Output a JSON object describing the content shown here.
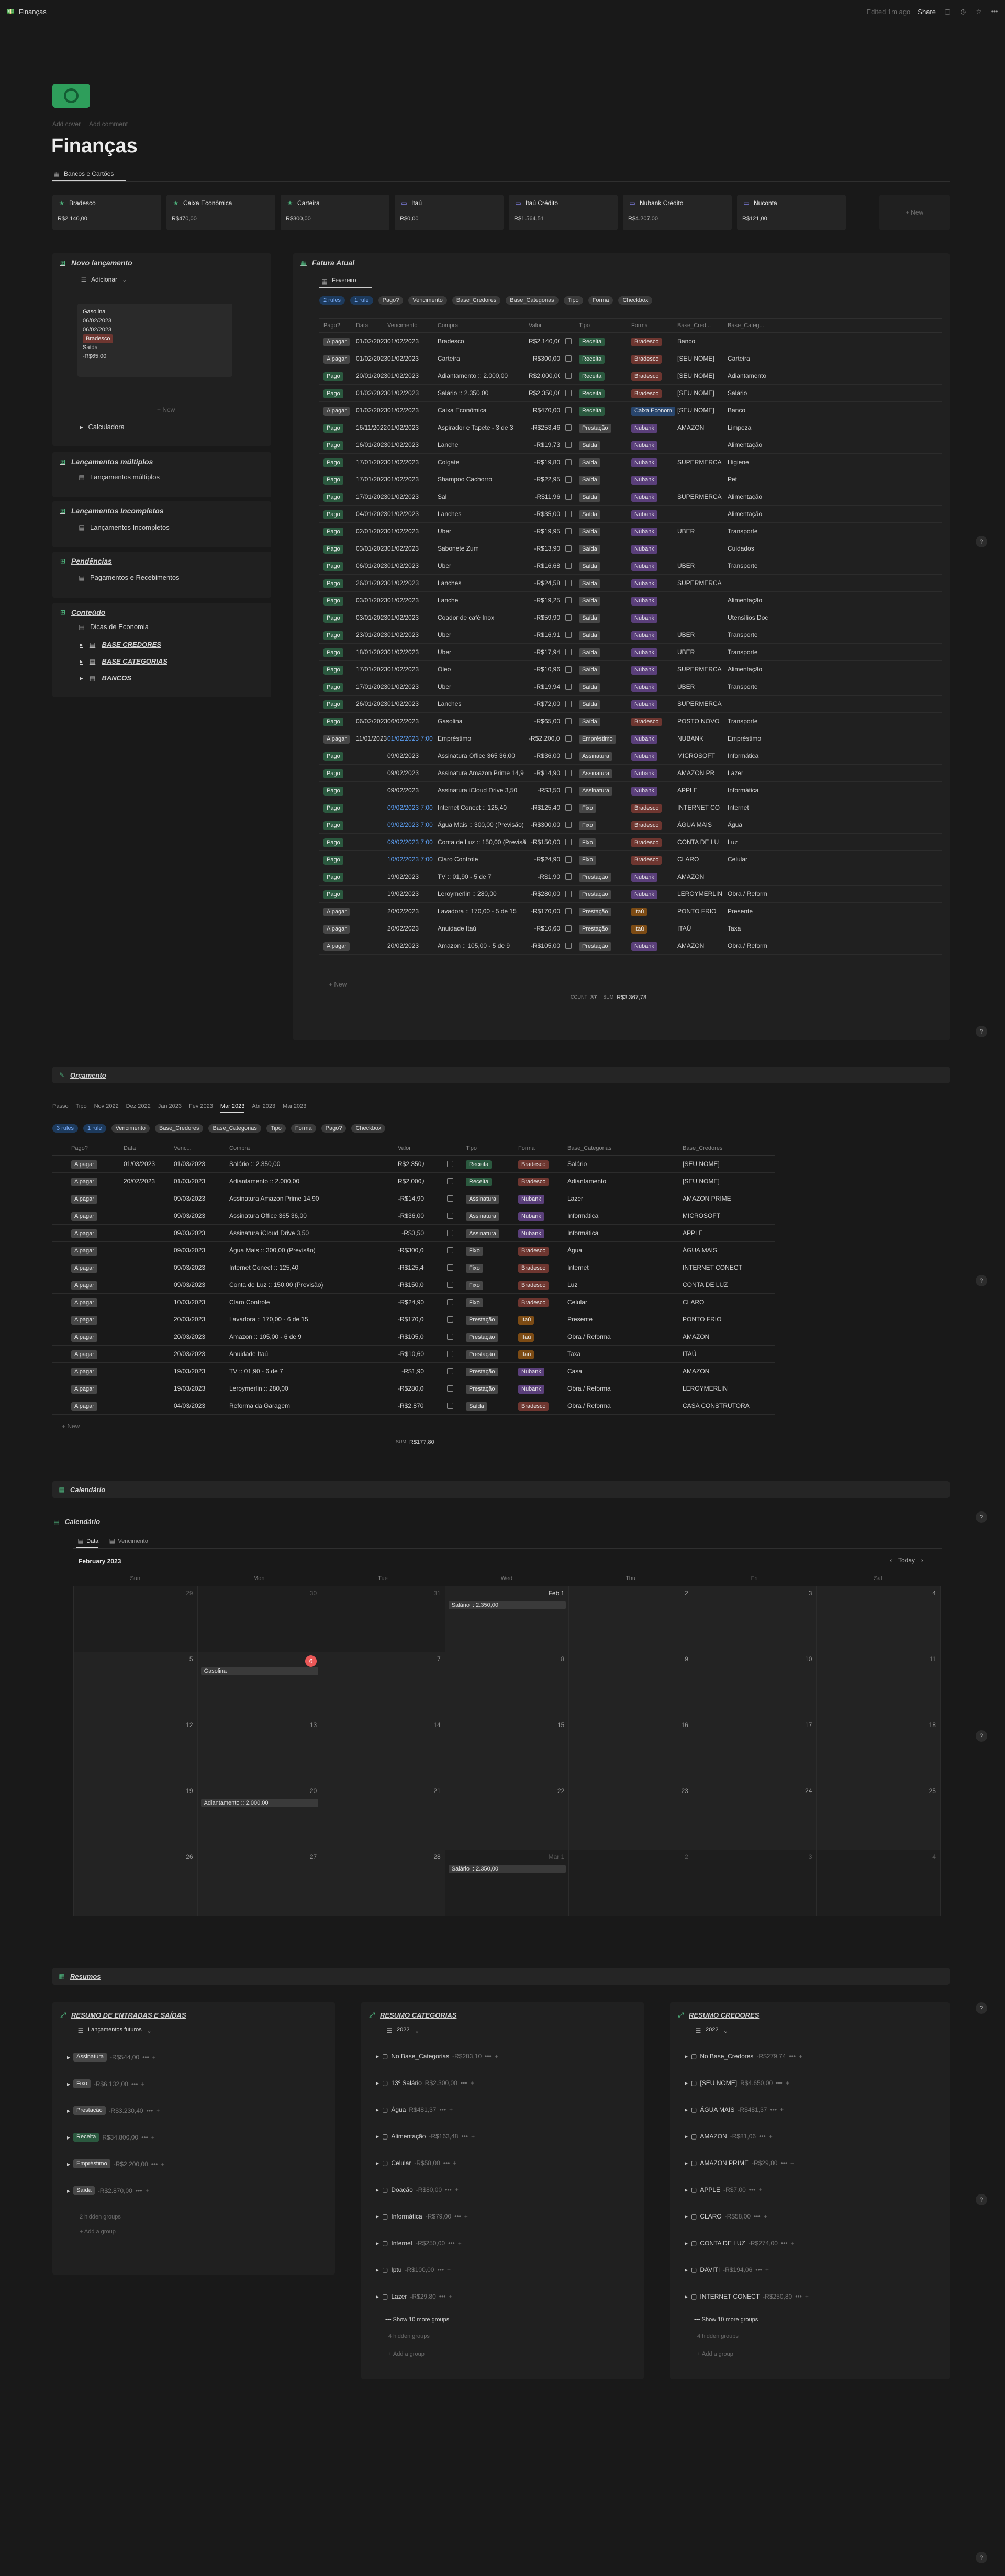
{
  "topbar": {
    "title": "Finanças",
    "edited": "Edited 1m ago",
    "share": "Share"
  },
  "page": {
    "add_cover": "Add cover",
    "add_comment": "Add comment",
    "title": "Finanças",
    "tab": "Bancos e Cartões"
  },
  "accounts": [
    {
      "name": "Bradesco",
      "value": "R$2.140,00",
      "icon": "star-icon"
    },
    {
      "name": "Caixa Econômica",
      "value": "R$470,00",
      "icon": "star-icon"
    },
    {
      "name": "Carteira",
      "value": "R$300,00",
      "icon": "star-icon"
    },
    {
      "name": "Itaú",
      "value": "R$0,00",
      "icon": "card-icon"
    },
    {
      "name": "Itaú Crédito",
      "value": "R$1.564,51",
      "icon": "card-icon"
    },
    {
      "name": "Nubank Crédito",
      "value": "R$4.207,00",
      "icon": "card-icon"
    },
    {
      "name": "Nuconta",
      "value": "R$121,00",
      "icon": "card-icon"
    }
  ],
  "accounts_new": "+ New",
  "left": {
    "novo": {
      "title": "Novo lançamento",
      "button": "Adicionar",
      "card": [
        "Gasolina",
        "06/02/2023",
        "06/02/2023",
        "Bradesco",
        "Saída",
        "-R$65,00"
      ],
      "new": "+ New",
      "calc": "Calculadora"
    },
    "multiplos": {
      "title": "Lançamentos múltiplos",
      "item": "Lançamentos múltiplos"
    },
    "incompletos": {
      "title": "Lançamentos Incompletos",
      "item": "Lançamentos Incompletos"
    },
    "pendencias": {
      "title": "Pendências",
      "item": "Pagamentos e Recebimentos"
    },
    "conteudo": {
      "title": "Conteúdo",
      "items": [
        "Dicas de Economia",
        "BASE CREDORES",
        "BASE CATEGORIAS",
        "BANCOS"
      ]
    }
  },
  "fatura": {
    "title": "Fatura Atual",
    "tab": "Fevereiro",
    "filters": [
      "Pago?",
      "Vencimento",
      "Base_Credores",
      "Base_Categorias",
      "Tipo",
      "Forma",
      "Checkbox"
    ],
    "filter_active1": "2 rules",
    "filter_active2": "1 rule",
    "headers": [
      "Pago?",
      "Data",
      "Vencimento",
      "Compra",
      "Valor",
      "",
      "Tipo",
      "Forma",
      "Base_Cred...",
      "Base_Categ..."
    ],
    "rows": [
      [
        "A pagar",
        "01/02/2023",
        "01/02/2023",
        "Bradesco",
        "R$2.140,00",
        "Receita",
        "Bradesco",
        "Banco",
        ""
      ],
      [
        "A pagar",
        "01/02/2023",
        "01/02/2023",
        "Carteira",
        "R$300,00",
        "Receita",
        "Bradesco",
        "[SEU NOME]",
        "Carteira"
      ],
      [
        "Pago",
        "20/01/2023",
        "01/02/2023",
        "Adiantamento :: 2.000,00",
        "R$2.000,00",
        "Receita",
        "Bradesco",
        "[SEU NOME]",
        "Adiantamento"
      ],
      [
        "Pago",
        "01/02/2023",
        "01/02/2023",
        "Salário :: 2.350,00",
        "R$2.350,00",
        "Receita",
        "Bradesco",
        "[SEU NOME]",
        "Salário"
      ],
      [
        "A pagar",
        "01/02/2023",
        "01/02/2023",
        "Caixa Econômica",
        "R$470,00",
        "Receita",
        "Caixa Econom",
        "[SEU NOME]",
        "Banco"
      ],
      [
        "Pago",
        "16/11/2022",
        "01/02/2023",
        "Aspirador e Tapete - 3 de 3",
        "-R$253,46",
        "Prestação",
        "Nubank",
        "AMAZON",
        "Limpeza"
      ],
      [
        "Pago",
        "16/01/2023",
        "01/02/2023",
        "Lanche",
        "-R$19,73",
        "Saída",
        "Nubank",
        "",
        "Alimentação"
      ],
      [
        "Pago",
        "17/01/2023",
        "01/02/2023",
        "Colgate",
        "-R$19,80",
        "Saída",
        "Nubank",
        "SUPERMERCA",
        "Higiene"
      ],
      [
        "Pago",
        "17/01/2023",
        "01/02/2023",
        "Shampoo Cachorro",
        "-R$22,95",
        "Saída",
        "Nubank",
        "",
        "Pet"
      ],
      [
        "Pago",
        "17/01/2023",
        "01/02/2023",
        "Sal",
        "-R$11,96",
        "Saída",
        "Nubank",
        "SUPERMERCA",
        "Alimentação"
      ],
      [
        "Pago",
        "04/01/2023",
        "01/02/2023",
        "Lanches",
        "-R$35,00",
        "Saída",
        "Nubank",
        "",
        "Alimentação"
      ],
      [
        "Pago",
        "02/01/2023",
        "01/02/2023",
        "Uber",
        "-R$19,95",
        "Saída",
        "Nubank",
        "UBER",
        "Transporte"
      ],
      [
        "Pago",
        "03/01/2023",
        "01/02/2023",
        "Sabonete Zum",
        "-R$13,90",
        "Saída",
        "Nubank",
        "",
        "Cuidados"
      ],
      [
        "Pago",
        "06/01/2023",
        "01/02/2023",
        "Uber",
        "-R$16,68",
        "Saída",
        "Nubank",
        "UBER",
        "Transporte"
      ],
      [
        "Pago",
        "26/01/2023",
        "01/02/2023",
        "Lanches",
        "-R$24,58",
        "Saída",
        "Nubank",
        "SUPERMERCA",
        ""
      ],
      [
        "Pago",
        "03/01/2023",
        "01/02/2023",
        "Lanche",
        "-R$19,25",
        "Saída",
        "Nubank",
        "",
        "Alimentação"
      ],
      [
        "Pago",
        "03/01/2023",
        "01/02/2023",
        "Coador de café Inox",
        "-R$59,90",
        "Saída",
        "Nubank",
        "",
        "Utensílios Doc"
      ],
      [
        "Pago",
        "23/01/2023",
        "01/02/2023",
        "Uber",
        "-R$16,91",
        "Saída",
        "Nubank",
        "UBER",
        "Transporte"
      ],
      [
        "Pago",
        "18/01/2023",
        "01/02/2023",
        "Uber",
        "-R$17,94",
        "Saída",
        "Nubank",
        "UBER",
        "Transporte"
      ],
      [
        "Pago",
        "17/01/2023",
        "01/02/2023",
        "Óleo",
        "-R$10,96",
        "Saída",
        "Nubank",
        "SUPERMERCA",
        "Alimentação"
      ],
      [
        "Pago",
        "17/01/2023",
        "01/02/2023",
        "Uber",
        "-R$19,94",
        "Saída",
        "Nubank",
        "UBER",
        "Transporte"
      ],
      [
        "Pago",
        "26/01/2023",
        "01/02/2023",
        "Lanches",
        "-R$72,00",
        "Saída",
        "Nubank",
        "SUPERMERCA",
        ""
      ],
      [
        "Pago",
        "06/02/2023",
        "06/02/2023",
        "Gasolina",
        "-R$65,00",
        "Saída",
        "Bradesco",
        "POSTO NOVO",
        "Transporte"
      ],
      [
        "A pagar",
        "11/01/2023",
        "01/02/2023 7:00",
        "Empréstimo",
        "-R$2.200,00",
        "Empréstimo",
        "Nubank",
        "NUBANK",
        "Empréstimo"
      ],
      [
        "Pago",
        "",
        "09/02/2023",
        "Assinatura Office 365 36,00",
        "-R$36,00",
        "Assinatura",
        "Nubank",
        "MICROSOFT",
        "Informática"
      ],
      [
        "Pago",
        "",
        "09/02/2023",
        "Assinatura Amazon Prime 14,9",
        "-R$14,90",
        "Assinatura",
        "Nubank",
        "AMAZON PR",
        "Lazer"
      ],
      [
        "Pago",
        "",
        "09/02/2023",
        "Assinatura iCloud Drive 3,50",
        "-R$3,50",
        "Assinatura",
        "Nubank",
        "APPLE",
        "Informática"
      ],
      [
        "Pago",
        "",
        "09/02/2023 7:00",
        "Internet Conect :: 125,40",
        "-R$125,40",
        "Fixo",
        "Bradesco",
        "INTERNET CO",
        "Internet"
      ],
      [
        "Pago",
        "",
        "09/02/2023 7:00",
        "Água Mais :: 300,00 (Previsão)",
        "-R$300,00",
        "Fixo",
        "Bradesco",
        "ÁGUA MAIS",
        "Água"
      ],
      [
        "Pago",
        "",
        "09/02/2023 7:00",
        "Conta de Luz :: 150,00 (Previsã",
        "-R$150,00",
        "Fixo",
        "Bradesco",
        "CONTA DE LU",
        "Luz"
      ],
      [
        "Pago",
        "",
        "10/02/2023 7:00",
        "Claro Controle",
        "-R$24,90",
        "Fixo",
        "Bradesco",
        "CLARO",
        "Celular"
      ],
      [
        "Pago",
        "",
        "19/02/2023",
        "TV :: 01,90 - 5 de 7",
        "-R$1,90",
        "Prestação",
        "Nubank",
        "AMAZON",
        ""
      ],
      [
        "Pago",
        "",
        "19/02/2023",
        "Leroymerlin :: 280,00",
        "-R$280,00",
        "Prestação",
        "Nubank",
        "LEROYMERLIN",
        "Obra / Reform"
      ],
      [
        "A pagar",
        "",
        "20/02/2023",
        "Lavadora :: 170,00 - 5 de 15",
        "-R$170,00",
        "Prestação",
        "Itaú",
        "PONTO FRIO",
        "Presente"
      ],
      [
        "A pagar",
        "",
        "20/02/2023",
        "Anuidade Itaú",
        "-R$10,60",
        "Prestação",
        "Itaú",
        "ITAÚ",
        "Taxa"
      ],
      [
        "A pagar",
        "",
        "20/02/2023",
        "Amazon :: 105,00 - 5 de 9",
        "-R$105,00",
        "Prestação",
        "Nubank",
        "AMAZON",
        "Obra / Reform"
      ]
    ],
    "new": "+ New",
    "count_label": "COUNT",
    "count": "37",
    "sum_label": "SUM",
    "sum": "R$3.367,78"
  },
  "orcamento": {
    "title": "Orçamento",
    "tabs": [
      "Passo",
      "Tipo",
      "Nov 2022",
      "Dez 2022",
      "Jan 2023",
      "Fev 2023",
      "Mar 2023",
      "Abr 2023",
      "Mai 2023"
    ],
    "active": "Mar 2023",
    "filters": [
      "Vencimento",
      "Base_Credores",
      "Base_Categorias",
      "Tipo",
      "Forma",
      "Pago?",
      "Checkbox"
    ],
    "filter_active1": "3 rules",
    "filter_active2": "1 rule",
    "headers": [
      "Pago?",
      "Data",
      "Venc...",
      "Compra",
      "Valor",
      "",
      "Tipo",
      "Forma",
      "Base_Categorias",
      "Base_Credores"
    ],
    "rows": [
      [
        "A pagar",
        "01/03/2023",
        "01/03/2023",
        "Salário :: 2.350,00",
        "R$2.350,00",
        "Receita",
        "Bradesco",
        "Salário",
        "[SEU NOME]"
      ],
      [
        "A pagar",
        "20/02/2023",
        "01/03/2023",
        "Adiantamento :: 2.000,00",
        "R$2.000,00",
        "Receita",
        "Bradesco",
        "Adiantamento",
        "[SEU NOME]"
      ],
      [
        "A pagar",
        "",
        "09/03/2023",
        "Assinatura Amazon Prime 14,90",
        "-R$14,90",
        "Assinatura",
        "Nubank",
        "Lazer",
        "AMAZON PRIME"
      ],
      [
        "A pagar",
        "",
        "09/03/2023",
        "Assinatura Office 365 36,00",
        "-R$36,00",
        "Assinatura",
        "Nubank",
        "Informática",
        "MICROSOFT"
      ],
      [
        "A pagar",
        "",
        "09/03/2023",
        "Assinatura iCloud Drive 3,50",
        "-R$3,50",
        "Assinatura",
        "Nubank",
        "Informática",
        "APPLE"
      ],
      [
        "A pagar",
        "",
        "09/03/2023",
        "Água Mais :: 300,00 (Previsão)",
        "-R$300,00",
        "Fixo",
        "Bradesco",
        "Água",
        "ÁGUA MAIS"
      ],
      [
        "A pagar",
        "",
        "09/03/2023",
        "Internet Conect :: 125,40",
        "-R$125,40",
        "Fixo",
        "Bradesco",
        "Internet",
        "INTERNET CONECT"
      ],
      [
        "A pagar",
        "",
        "09/03/2023",
        "Conta de Luz :: 150,00 (Previsão)",
        "-R$150,00",
        "Fixo",
        "Bradesco",
        "Luz",
        "CONTA DE LUZ"
      ],
      [
        "A pagar",
        "",
        "10/03/2023",
        "Claro Controle",
        "-R$24,90",
        "Fixo",
        "Bradesco",
        "Celular",
        "CLARO"
      ],
      [
        "A pagar",
        "",
        "20/03/2023",
        "Lavadora :: 170,00 - 6 de 15",
        "-R$170,00",
        "Prestação",
        "Itaú",
        "Presente",
        "PONTO FRIO"
      ],
      [
        "A pagar",
        "",
        "20/03/2023",
        "Amazon :: 105,00 - 6 de 9",
        "-R$105,00",
        "Prestação",
        "Itaú",
        "Obra / Reforma",
        "AMAZON"
      ],
      [
        "A pagar",
        "",
        "20/03/2023",
        "Anuidade Itaú",
        "-R$10,60",
        "Prestação",
        "Itaú",
        "Taxa",
        "ITAÚ"
      ],
      [
        "A pagar",
        "",
        "19/03/2023",
        "TV :: 01,90 - 6 de 7",
        "-R$1,90",
        "Prestação",
        "Nubank",
        "Casa",
        "AMAZON"
      ],
      [
        "A pagar",
        "",
        "19/03/2023",
        "Leroymerlin :: 280,00",
        "-R$280,00",
        "Prestação",
        "Nubank",
        "Obra / Reforma",
        "LEROYMERLIN"
      ],
      [
        "A pagar",
        "",
        "04/03/2023",
        "Reforma da Garagem",
        "-R$2.870,00",
        "Saída",
        "Bradesco",
        "Obra / Reforma",
        "CASA CONSTRUTORA"
      ]
    ],
    "new": "+ New",
    "sum_label": "SUM",
    "sum": "R$177,80"
  },
  "calendario": {
    "title": "Calendário",
    "view_title": "Calendário",
    "tabs": [
      "Data",
      "Vencimento"
    ],
    "month": "February 2023",
    "today": "Today",
    "weekdays": [
      "Sun",
      "Mon",
      "Tue",
      "Wed",
      "Thu",
      "Fri",
      "Sat"
    ],
    "days": [
      "29",
      "30",
      "31",
      "Feb 1",
      "2",
      "3",
      "4",
      "5",
      "6",
      "7",
      "8",
      "9",
      "10",
      "11",
      "12",
      "13",
      "14",
      "15",
      "16",
      "17",
      "18",
      "19",
      "20",
      "21",
      "22",
      "23",
      "24",
      "25",
      "26",
      "27",
      "28",
      "Mar 1",
      "2",
      "3",
      "4"
    ],
    "events": [
      {
        "day": 3,
        "text": "Salário :: 2.350,00"
      },
      {
        "day": 8,
        "text": "Gasolina"
      },
      {
        "day": 22,
        "text": "Adiantamento :: 2.000,00"
      },
      {
        "day": 31,
        "text": "Salário :: 2.350,00"
      }
    ],
    "today_day": "6"
  },
  "resumos": {
    "title": "Resumos",
    "entradas": {
      "title": "RESUMO DE ENTRADAS E SAÍDAS",
      "view": "Lançamentos futuros",
      "groups": [
        [
          "Assinatura",
          "-R$544,00"
        ],
        [
          "Fixo",
          "-R$6.132,00"
        ],
        [
          "Prestação",
          "-R$3.230,40"
        ],
        [
          "Receita",
          "R$34.800,00"
        ],
        [
          "Empréstimo",
          "-R$2.200,00"
        ],
        [
          "Saída",
          "-R$2.870,00"
        ]
      ],
      "hidden": "2 hidden groups",
      "add": "+ Add a group"
    },
    "categorias": {
      "title": "RESUMO CATEGORIAS",
      "view": "2022",
      "groups": [
        [
          "No Base_Categorias",
          "-R$283,10"
        ],
        [
          "13º Salário",
          "R$2.300,00"
        ],
        [
          "Água",
          "R$481,37"
        ],
        [
          "Alimentação",
          "-R$163,48"
        ],
        [
          "Celular",
          "-R$58,00"
        ],
        [
          "Doação",
          "-R$80,00"
        ],
        [
          "Informática",
          "-R$79,00"
        ],
        [
          "Internet",
          "-R$250,00"
        ],
        [
          "Iptu",
          "-R$100,00"
        ],
        [
          "Lazer",
          "-R$29,80"
        ]
      ],
      "show_more": "Show 10 more groups",
      "hidden": "4 hidden groups",
      "add": "+ Add a group"
    },
    "credores": {
      "title": "RESUMO CREDORES",
      "view": "2022",
      "groups": [
        [
          "No Base_Credores",
          "-R$279,74"
        ],
        [
          "[SEU NOME]",
          "R$4.650,00"
        ],
        [
          "ÁGUA MAIS",
          "-R$481,37"
        ],
        [
          "AMAZON",
          "-R$81,06"
        ],
        [
          "AMAZON PRIME",
          "-R$29,80"
        ],
        [
          "APPLE",
          "-R$7,00"
        ],
        [
          "CLARO",
          "-R$58,00"
        ],
        [
          "CONTA DE LUZ",
          "-R$274,00"
        ],
        [
          "DAVITI",
          "-R$194,06"
        ],
        [
          "INTERNET CONECT",
          "-R$250,80"
        ]
      ],
      "show_more": "Show 10 more groups",
      "hidden": "4 hidden groups",
      "add": "+ Add a group"
    }
  }
}
